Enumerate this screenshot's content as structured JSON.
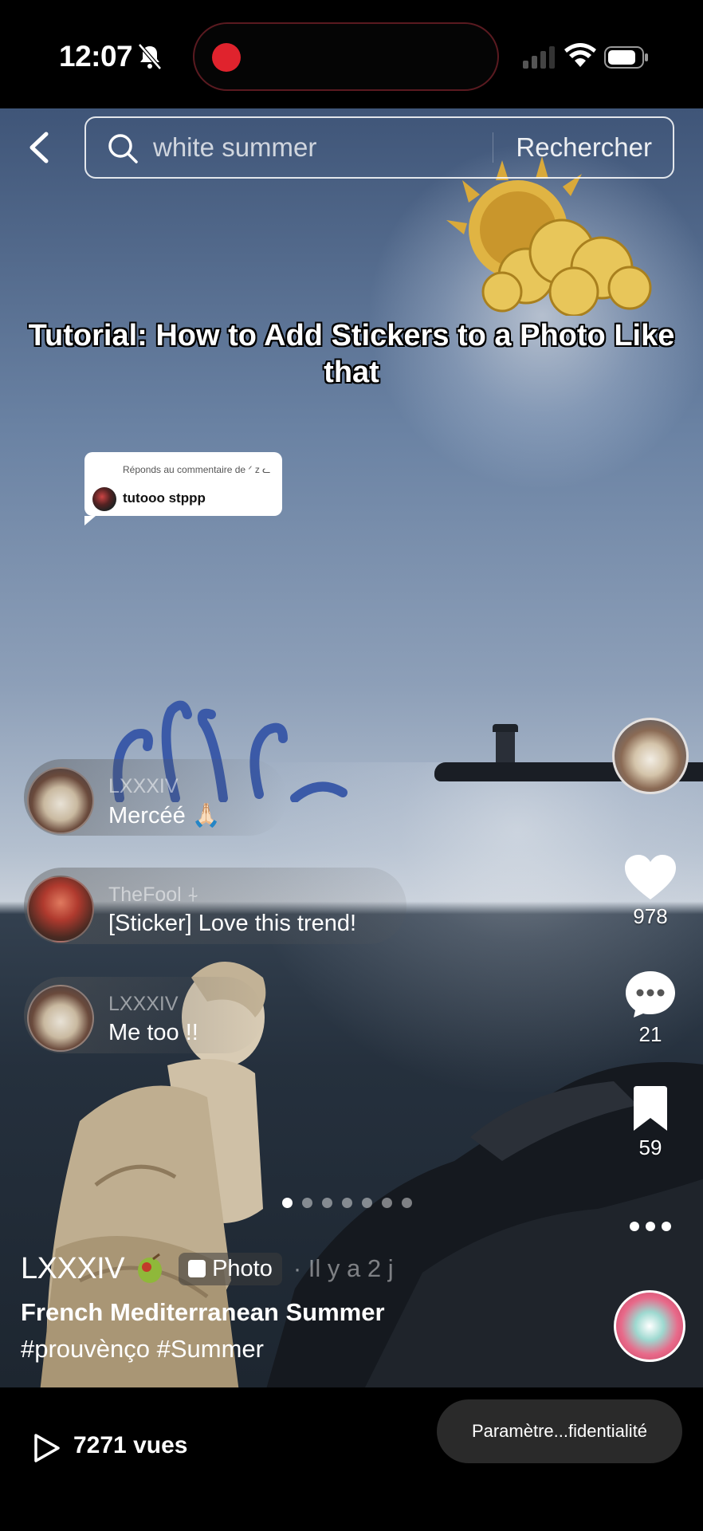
{
  "status_bar": {
    "time": "12:07"
  },
  "search": {
    "query": "white summer",
    "button_label": "Rechercher"
  },
  "post": {
    "title": "Tutorial: How to Add Stickers to a Photo Like that",
    "reply": {
      "header": "Réponds au commentaire de ᐟ z ᓚ",
      "text": "tutooo stppp"
    }
  },
  "comments": [
    {
      "user": "LXXXIV",
      "text": "Mercéé 🙏🏻"
    },
    {
      "user": "TheFool ⍭",
      "text": "[Sticker] Love this trend!"
    },
    {
      "user": "LXXXIV",
      "text": "Me too !!"
    }
  ],
  "actions": {
    "likes": "978",
    "comments": "21",
    "saves": "59"
  },
  "carousel": {
    "total": 7,
    "active": 1
  },
  "caption": {
    "author": "LXXXIV",
    "badge": "Photo",
    "time_ago": "· Il y a 2 j",
    "title": "French Mediterranean Summer",
    "tags": "#prouvènço #Summer"
  },
  "bottom": {
    "views": "7271 vues",
    "privacy_label": "Paramètre...fidentialité"
  },
  "colors": {
    "record": "#e0232d",
    "background": "#000000"
  }
}
